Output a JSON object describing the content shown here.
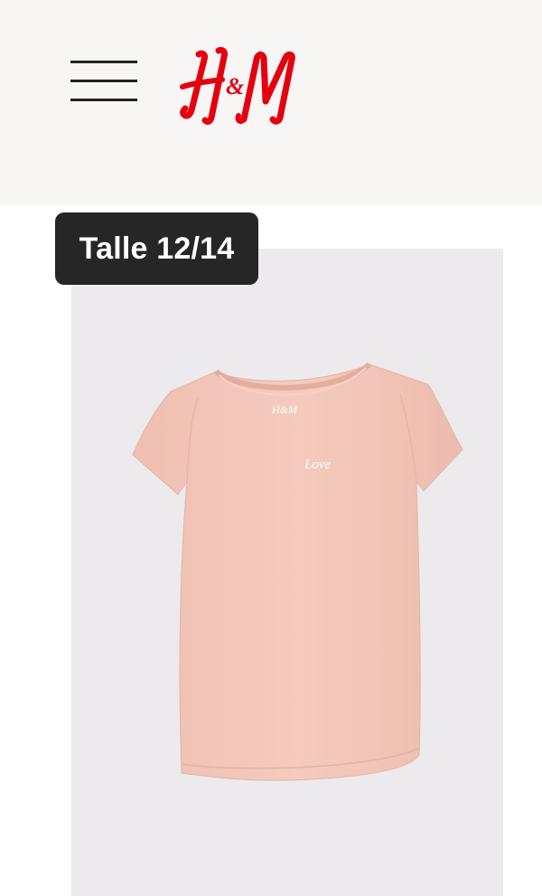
{
  "header": {
    "menu_icon": "hamburger-menu-icon",
    "logo_text": "H&M",
    "brand_color": "#e50010",
    "background": "#f8f6f5"
  },
  "product": {
    "size_label": "Talle 12/14",
    "image_description_icon": "t-shirt-image",
    "shirt_print": "Love",
    "shirt_label_text": "H&M",
    "shirt_color": "#f2c7ba",
    "image_background": "#eceaec"
  },
  "badge": {
    "background": "#262626",
    "text_color": "#ffffff"
  }
}
